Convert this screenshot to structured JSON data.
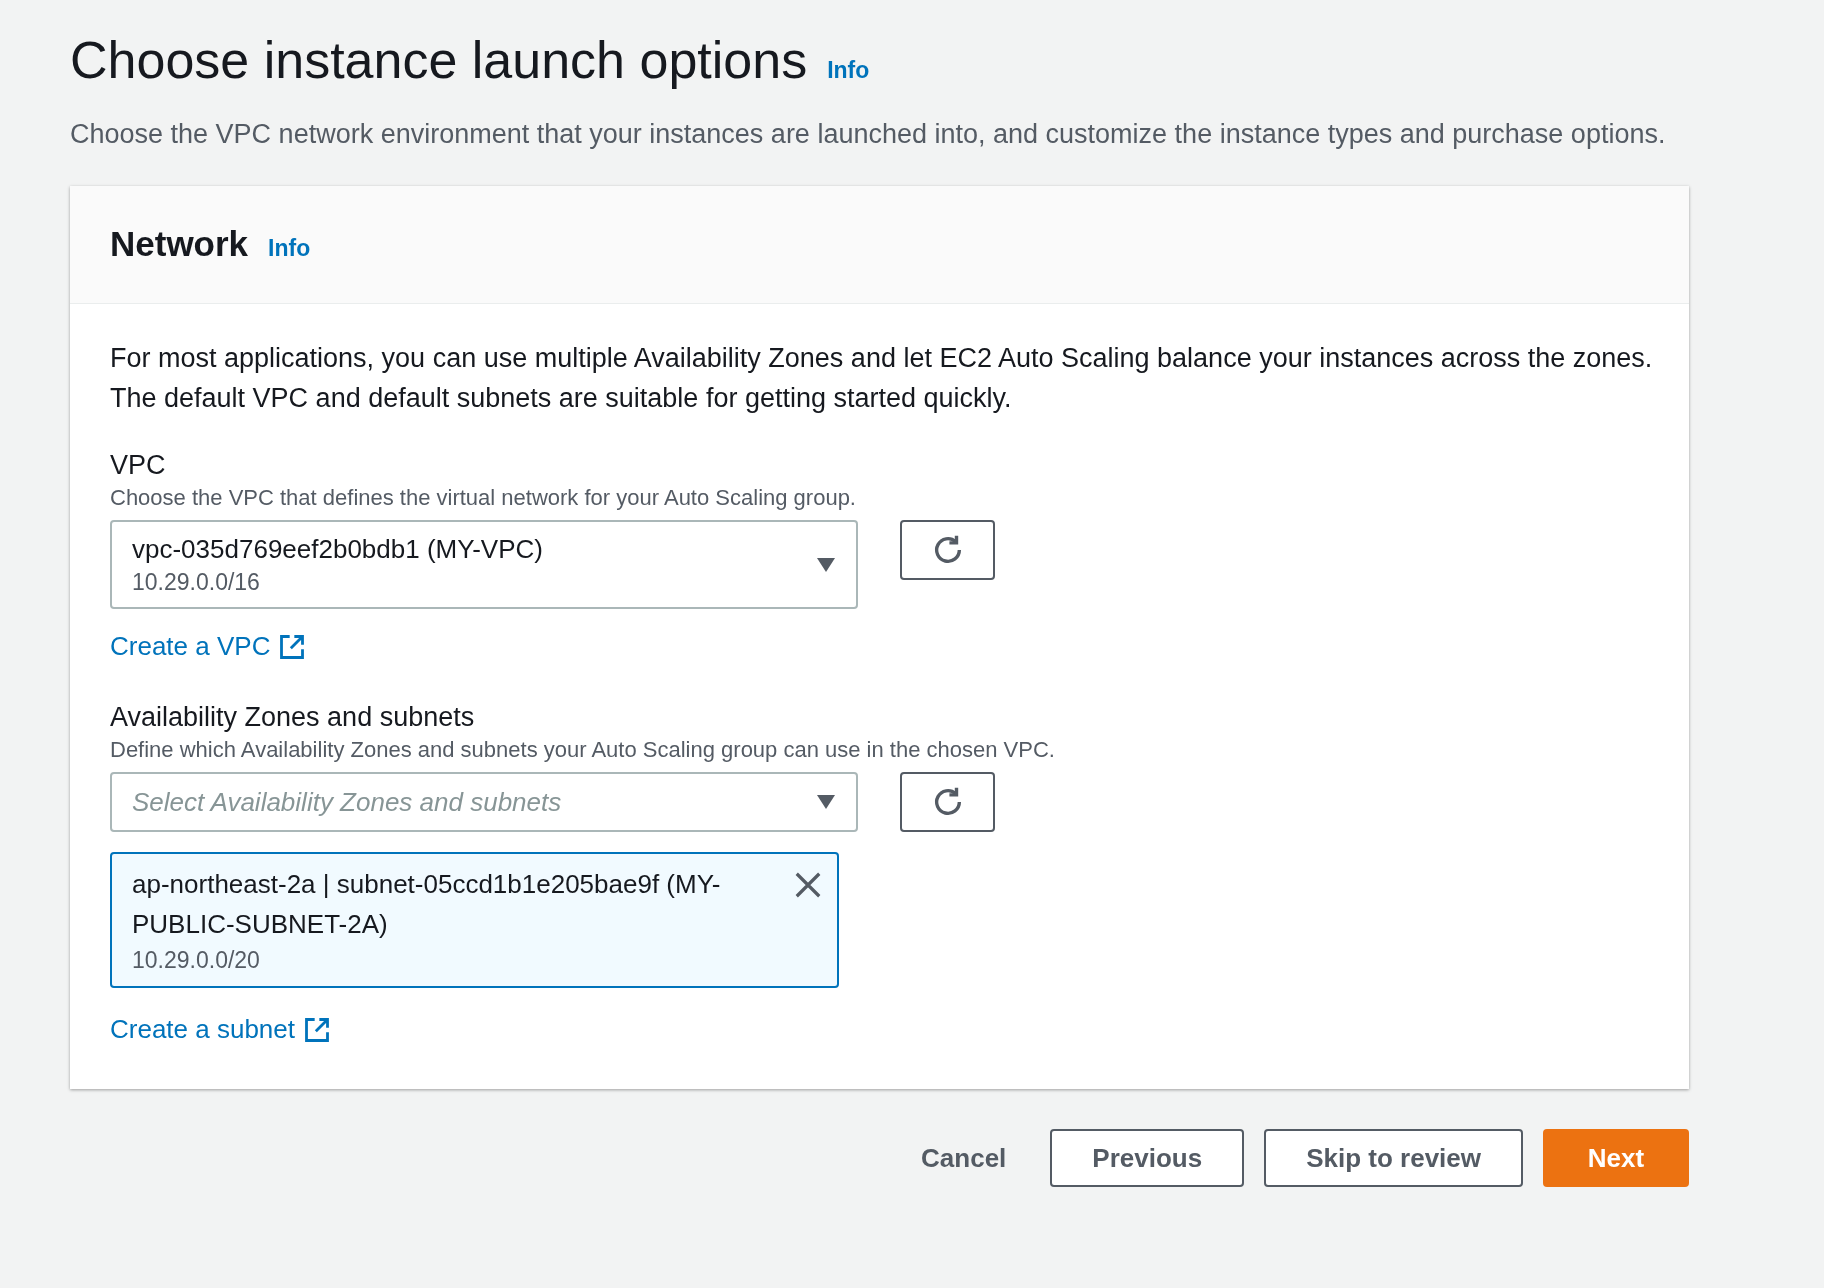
{
  "page": {
    "title": "Choose instance launch options",
    "info": "Info",
    "description": "Choose the VPC network environment that your instances are launched into, and customize the instance types and purchase options."
  },
  "network": {
    "title": "Network",
    "info": "Info",
    "intro": "For most applications, you can use multiple Availability Zones and let EC2 Auto Scaling balance your instances across the zones. The default VPC and default subnets are suitable for getting started quickly.",
    "vpc": {
      "label": "VPC",
      "hint": "Choose the VPC that defines the virtual network for your Auto Scaling group.",
      "value": "vpc-035d769eef2b0bdb1 (MY-VPC)",
      "detail": "10.29.0.0/16",
      "link": "Create a VPC"
    },
    "subnets": {
      "label": "Availability Zones and subnets",
      "hint": "Define which Availability Zones and subnets your Auto Scaling group can use in the chosen VPC.",
      "placeholder": "Select Availability Zones and subnets",
      "tokens": [
        {
          "value": "ap-northeast-2a | subnet-05ccd1b1e205bae9f (MY-PUBLIC-SUBNET-2A)",
          "detail": "10.29.0.0/20"
        }
      ],
      "link": "Create a subnet"
    }
  },
  "actions": [
    {
      "label": "Cancel",
      "kind": "link"
    },
    {
      "label": "Previous",
      "kind": "normal"
    },
    {
      "label": "Skip to review",
      "kind": "normal"
    },
    {
      "label": "Next",
      "kind": "primary"
    }
  ]
}
